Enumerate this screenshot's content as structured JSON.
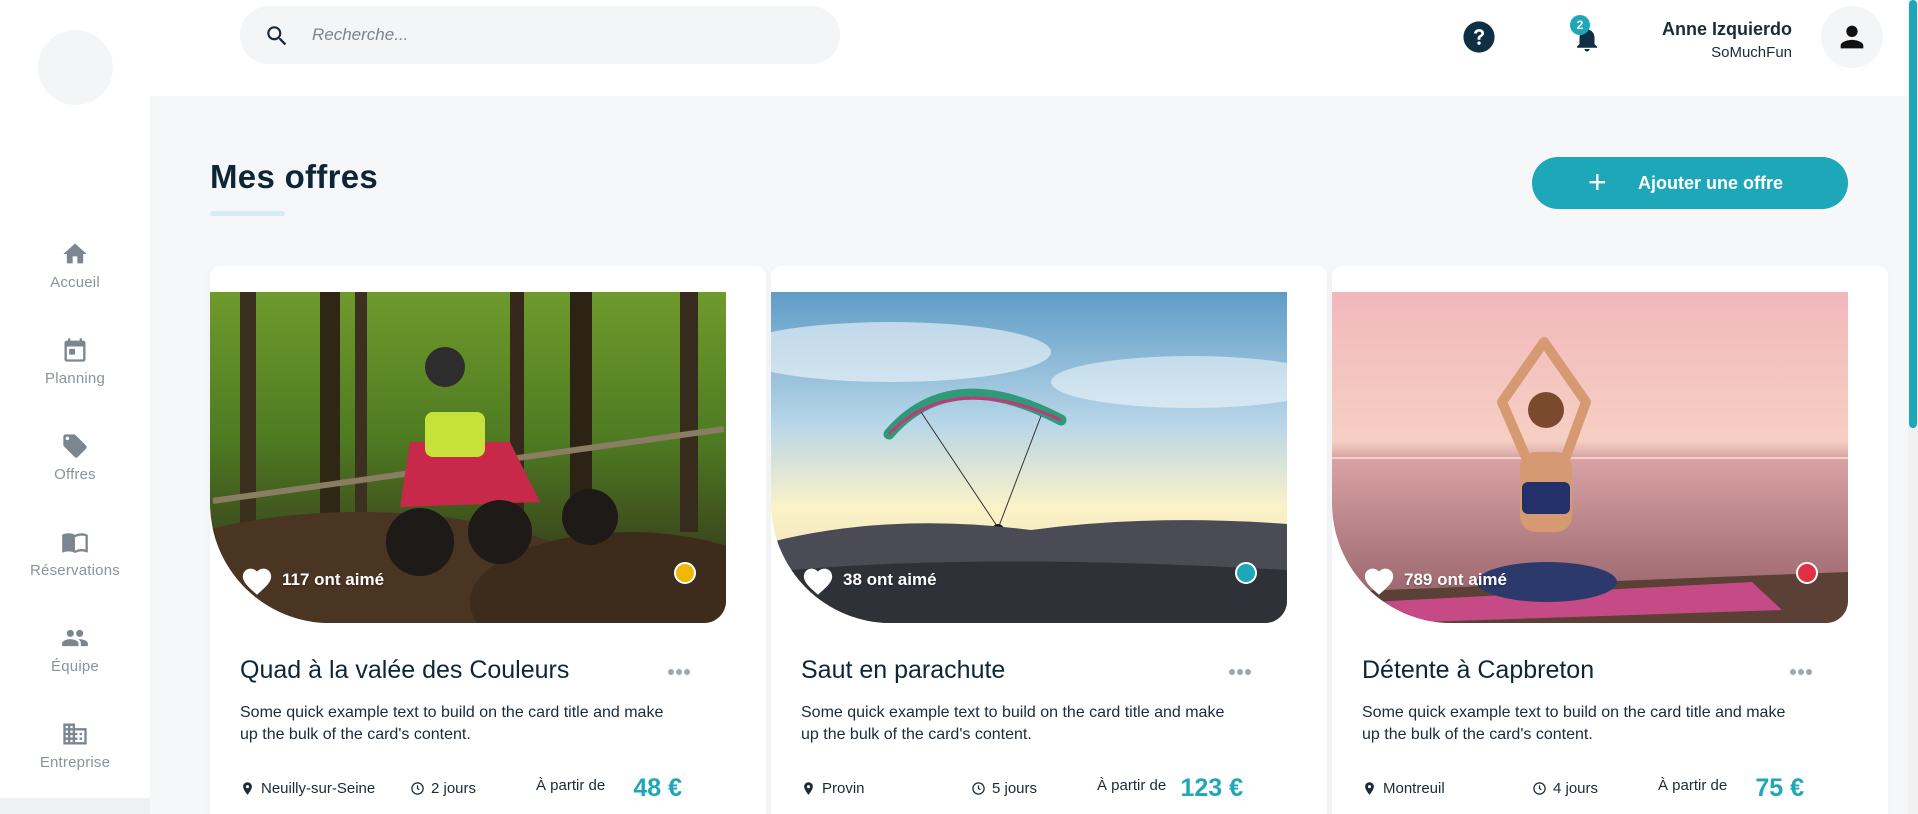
{
  "sidebar": {
    "items": [
      {
        "label": "Accueil",
        "icon": "home-icon"
      },
      {
        "label": "Planning",
        "icon": "calendar-icon"
      },
      {
        "label": "Offres",
        "icon": "tag-icon"
      },
      {
        "label": "Réservations",
        "icon": "book-icon"
      },
      {
        "label": "Équipe",
        "icon": "team-icon"
      },
      {
        "label": "Entreprise",
        "icon": "building-icon"
      }
    ]
  },
  "header": {
    "search_placeholder": "Recherche...",
    "notifications_count": "2",
    "user_name": "Anne Izquierdo",
    "user_company": "SoMuchFun"
  },
  "main": {
    "title": "Mes offres",
    "add_button_label": "Ajouter une offre"
  },
  "colors": {
    "accent": "#1ea6b9",
    "status_yellow": "#f2b705",
    "status_teal": "#1ea6b9",
    "status_red": "#e03045"
  },
  "offers": [
    {
      "title": "Quad à la valée des Couleurs",
      "likes": "117 ont aimé",
      "description": "Some quick example text to build on the card title and make up the bulk of the card's content.",
      "location": "Neuilly-sur-Seine",
      "duration": "2 jours",
      "from_label": "À partir de",
      "price": "48 €",
      "status_color": "#f2b705"
    },
    {
      "title": "Saut en parachute",
      "likes": "38 ont aimé",
      "description": "Some quick example text to build on the card title and make up the bulk of the card's content.",
      "location": "Provin",
      "duration": "5 jours",
      "from_label": "À partir de",
      "price": "123 €",
      "status_color": "#1ea6b9"
    },
    {
      "title": "Détente à Capbreton",
      "likes": "789 ont aimé",
      "description": "Some quick example text to build on the card title and make up the bulk of the card's content.",
      "location": "Montreuil",
      "duration": "4 jours",
      "from_label": "À partir de",
      "price": "75 €",
      "status_color": "#e03045"
    }
  ]
}
